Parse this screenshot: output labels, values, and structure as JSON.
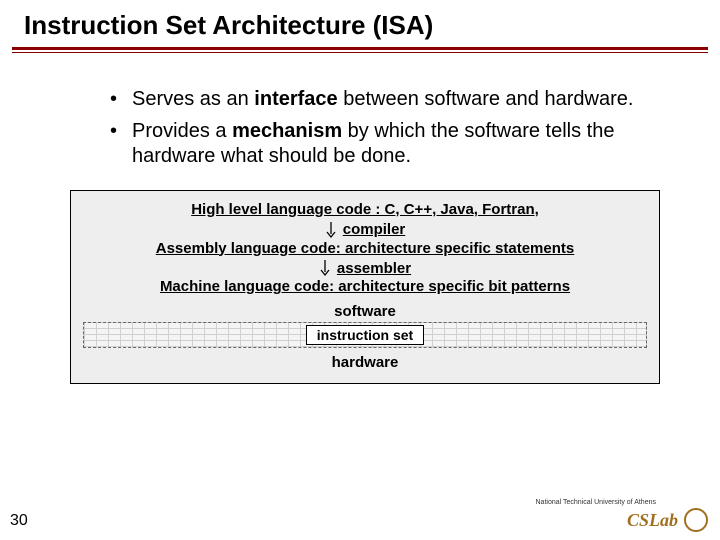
{
  "title": "Instruction Set Architecture (ISA)",
  "bullets": [
    {
      "pre": "Serves as an ",
      "bold": "interface",
      "post": " between software and hardware."
    },
    {
      "pre": "Provides a ",
      "bold": "mechanism",
      "post": " by which the software tells the hardware what should be done."
    }
  ],
  "diagram": {
    "line1": "High level language code : C, C++, Java, Fortran,",
    "arrow1_label": "compiler",
    "line2": "Assembly language code: architecture specific statements",
    "arrow2_label": "assembler",
    "line3": "Machine language code: architecture specific bit patterns",
    "software": "software",
    "isa": "instruction set",
    "hardware": "hardware"
  },
  "slide_number": "30",
  "logo_text": "CSLab",
  "logo_tag": "National Technical University of Athens"
}
